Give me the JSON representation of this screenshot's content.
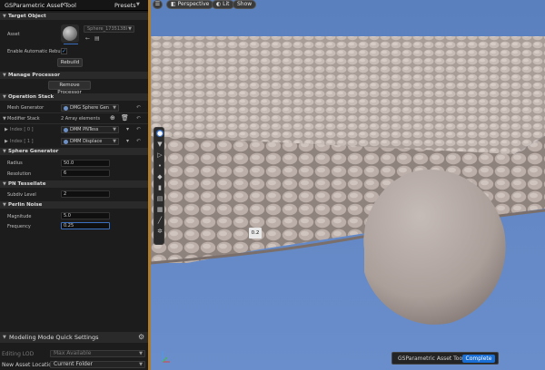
{
  "panel": {
    "title": "GSParametric Asset Tool",
    "close_glyph": "×",
    "presets_label": "Presets"
  },
  "target_object": {
    "section_label": "Target Object",
    "asset_label": "Asset",
    "asset_value": "Sphere_173513BI",
    "enable_rebuild_label": "Enable Automatic Rebuild",
    "rebuild_button": "Rebuild"
  },
  "manage_processor": {
    "section_label": "Manage Processor",
    "remove_button": "Remove Processor"
  },
  "operation_stack": {
    "section_label": "Operation Stack",
    "mesh_generator_label": "Mesh Generator",
    "mesh_generator_value": "DMG Sphere Gen",
    "modifier_stack_label": "Modifier Stack",
    "modifier_stack_count": "2 Array elements",
    "index0_label": "Index [ 0 ]",
    "index0_value": "DMM PNTess",
    "index1_label": "Index [ 1 ]",
    "index1_value": "DMM Displace"
  },
  "sphere_generator": {
    "section_label": "Sphere Generator",
    "radius_label": "Radius",
    "radius_value": "50.0",
    "resolution_label": "Resolution",
    "resolution_value": "6"
  },
  "pn_tessellate": {
    "section_label": "PN Tessellate",
    "subdiv_label": "Subdiv Level",
    "subdiv_value": "2"
  },
  "perlin_noise": {
    "section_label": "Perlin Noise",
    "magnitude_label": "Magnitude",
    "magnitude_value": "5.0",
    "frequency_label": "Frequency",
    "frequency_value": "0.25"
  },
  "tooltip_value": "0.2",
  "quick_settings": {
    "title": "Modeling Mode Quick Settings",
    "editing_lod_label": "Editing LOD",
    "editing_lod_value": "Max Available",
    "new_asset_location_label": "New Asset Location",
    "new_asset_location_value": "Current Folder"
  },
  "viewport": {
    "perspective_label": "Perspective",
    "lit_label": "Lit",
    "show_label": "Show"
  },
  "status": {
    "tool_label": "GSParametric Asset Tool",
    "complete_button": "Complete"
  },
  "colors": {
    "accent_orange": "#b07d2a",
    "complete_blue": "#1a6fd6",
    "sky_blue": "#5f86c0",
    "ground_gray": "#b8aba6"
  }
}
